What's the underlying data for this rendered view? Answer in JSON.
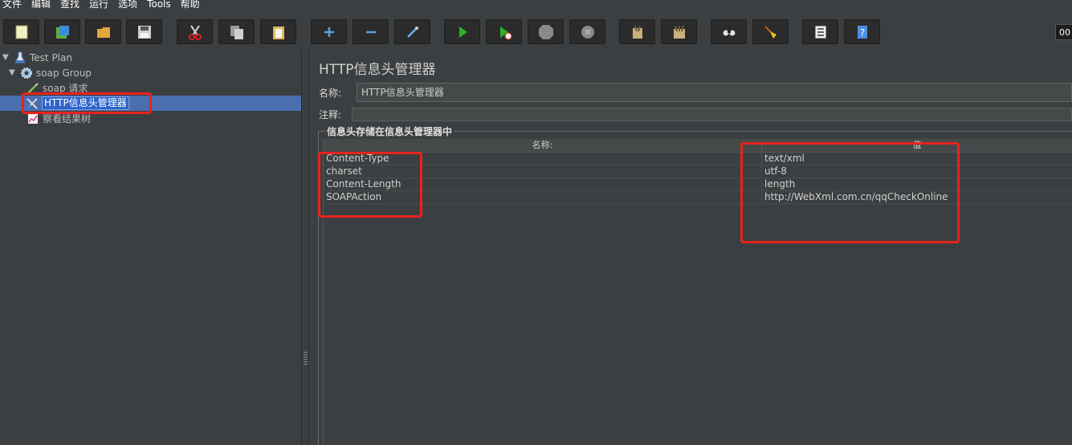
{
  "menu": [
    "文件",
    "编辑",
    "查找",
    "运行",
    "选项",
    "Tools",
    "帮助"
  ],
  "toolbar": {
    "buttons": [
      {
        "name": "new-icon",
        "color": "#f3f0c2"
      },
      {
        "name": "templates-icon",
        "color": "#5fae49"
      },
      {
        "name": "open-icon",
        "color": "#e1a73a"
      },
      {
        "name": "save-icon",
        "color": "#d0d0d0"
      },
      {
        "name": "cut-icon",
        "color": "#d92121"
      },
      {
        "name": "copy-icon",
        "color": "#cfcfcf"
      },
      {
        "name": "paste-icon",
        "color": "#e1b75a"
      },
      {
        "name": "expand-icon",
        "color": "#5aa0e6"
      },
      {
        "name": "collapse-icon",
        "color": "#5aa0e6"
      },
      {
        "name": "toggle-icon",
        "color": "#6fb0e8"
      },
      {
        "name": "start-icon",
        "color": "#2fb12a"
      },
      {
        "name": "start-no-pauses-icon",
        "color": "#2fb12a"
      },
      {
        "name": "stop-icon",
        "color": "#8a8a8a"
      },
      {
        "name": "shutdown-icon",
        "color": "#8a8a8a"
      },
      {
        "name": "clear-icon",
        "color": "#c9b07a"
      },
      {
        "name": "clear-all-icon",
        "color": "#c9b07a"
      },
      {
        "name": "search-icon",
        "color": "#d0d0d0"
      },
      {
        "name": "reset-search-icon",
        "color": "#f0c419"
      },
      {
        "name": "function-helper-icon",
        "color": "#e0e0e0"
      },
      {
        "name": "help-icon",
        "color": "#4a90e2"
      }
    ],
    "time_readout": "00"
  },
  "tree": {
    "test_plan": "Test Plan",
    "thread_group": "soap Group",
    "sampler": "soap 请求",
    "header_manager": "HTTP信息头管理器",
    "listener": "察看结果树"
  },
  "panel": {
    "title": "HTTP信息头管理器",
    "name_label": "名称:",
    "name_value": "HTTP信息头管理器",
    "comment_label": "注释:",
    "group_title": "信息头存储在信息头管理器中",
    "columns": [
      "名称:",
      "值"
    ],
    "rows": [
      {
        "name": "Content-Type",
        "value": "text/xml"
      },
      {
        "name": "charset",
        "value": "utf-8"
      },
      {
        "name": "Content-Length",
        "value": "length"
      },
      {
        "name": "SOAPAction",
        "value": "http://WebXml.com.cn/qqCheckOnline"
      }
    ]
  },
  "colors": {
    "background": "#3c3f41",
    "selection": "#4b6eaf",
    "annotation_red": "#e8231c"
  }
}
